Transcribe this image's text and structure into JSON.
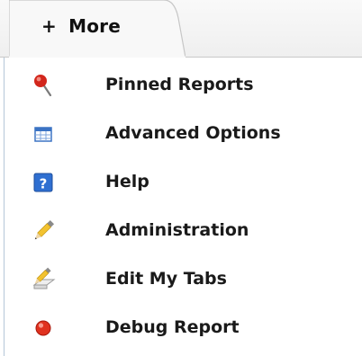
{
  "tab": {
    "plus": "+",
    "label": "More"
  },
  "menu": {
    "items": [
      {
        "label": "Pinned Reports",
        "icon": "pin-icon"
      },
      {
        "label": "Advanced Options",
        "icon": "table-grid-icon"
      },
      {
        "label": "Help",
        "icon": "help-icon"
      },
      {
        "label": "Administration",
        "icon": "pencil-icon"
      },
      {
        "label": "Edit My Tabs",
        "icon": "edit-tabs-icon"
      },
      {
        "label": "Debug Report",
        "icon": "red-dot-icon"
      }
    ]
  },
  "colors": {
    "pin_head": "#d2261c",
    "grid_blue": "#3b73c4",
    "help_blue": "#2f6fd1",
    "debug_red": "#e0321f"
  }
}
